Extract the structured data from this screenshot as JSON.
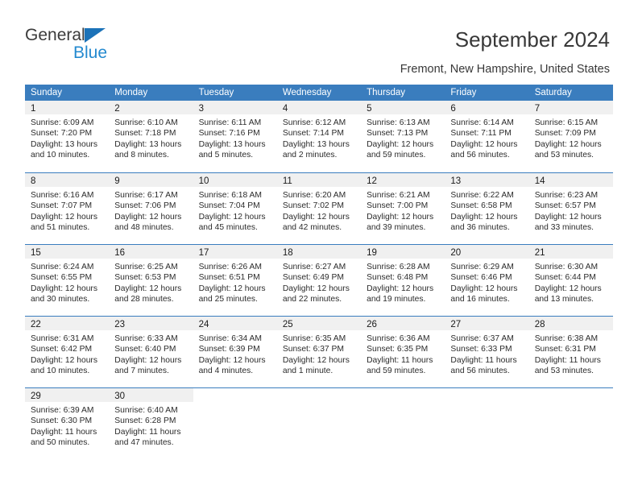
{
  "brand": {
    "name_top": "General",
    "name_bottom": "Blue",
    "accent_color": "#2389cf",
    "triangle_color": "#1b72b8"
  },
  "header": {
    "title": "September 2024",
    "location": "Fremont, New Hampshire, United States"
  },
  "theme": {
    "header_row_bg": "#3a7dbe",
    "daynum_bg": "#f0f0f0",
    "rule_color": "#3a7dbe",
    "text_color": "#2b2b2b"
  },
  "weekdays": [
    "Sunday",
    "Monday",
    "Tuesday",
    "Wednesday",
    "Thursday",
    "Friday",
    "Saturday"
  ],
  "weeks": [
    [
      {
        "day": "1",
        "sunrise": "Sunrise: 6:09 AM",
        "sunset": "Sunset: 7:20 PM",
        "daylight1": "Daylight: 13 hours",
        "daylight2": "and 10 minutes."
      },
      {
        "day": "2",
        "sunrise": "Sunrise: 6:10 AM",
        "sunset": "Sunset: 7:18 PM",
        "daylight1": "Daylight: 13 hours",
        "daylight2": "and 8 minutes."
      },
      {
        "day": "3",
        "sunrise": "Sunrise: 6:11 AM",
        "sunset": "Sunset: 7:16 PM",
        "daylight1": "Daylight: 13 hours",
        "daylight2": "and 5 minutes."
      },
      {
        "day": "4",
        "sunrise": "Sunrise: 6:12 AM",
        "sunset": "Sunset: 7:14 PM",
        "daylight1": "Daylight: 13 hours",
        "daylight2": "and 2 minutes."
      },
      {
        "day": "5",
        "sunrise": "Sunrise: 6:13 AM",
        "sunset": "Sunset: 7:13 PM",
        "daylight1": "Daylight: 12 hours",
        "daylight2": "and 59 minutes."
      },
      {
        "day": "6",
        "sunrise": "Sunrise: 6:14 AM",
        "sunset": "Sunset: 7:11 PM",
        "daylight1": "Daylight: 12 hours",
        "daylight2": "and 56 minutes."
      },
      {
        "day": "7",
        "sunrise": "Sunrise: 6:15 AM",
        "sunset": "Sunset: 7:09 PM",
        "daylight1": "Daylight: 12 hours",
        "daylight2": "and 53 minutes."
      }
    ],
    [
      {
        "day": "8",
        "sunrise": "Sunrise: 6:16 AM",
        "sunset": "Sunset: 7:07 PM",
        "daylight1": "Daylight: 12 hours",
        "daylight2": "and 51 minutes."
      },
      {
        "day": "9",
        "sunrise": "Sunrise: 6:17 AM",
        "sunset": "Sunset: 7:06 PM",
        "daylight1": "Daylight: 12 hours",
        "daylight2": "and 48 minutes."
      },
      {
        "day": "10",
        "sunrise": "Sunrise: 6:18 AM",
        "sunset": "Sunset: 7:04 PM",
        "daylight1": "Daylight: 12 hours",
        "daylight2": "and 45 minutes."
      },
      {
        "day": "11",
        "sunrise": "Sunrise: 6:20 AM",
        "sunset": "Sunset: 7:02 PM",
        "daylight1": "Daylight: 12 hours",
        "daylight2": "and 42 minutes."
      },
      {
        "day": "12",
        "sunrise": "Sunrise: 6:21 AM",
        "sunset": "Sunset: 7:00 PM",
        "daylight1": "Daylight: 12 hours",
        "daylight2": "and 39 minutes."
      },
      {
        "day": "13",
        "sunrise": "Sunrise: 6:22 AM",
        "sunset": "Sunset: 6:58 PM",
        "daylight1": "Daylight: 12 hours",
        "daylight2": "and 36 minutes."
      },
      {
        "day": "14",
        "sunrise": "Sunrise: 6:23 AM",
        "sunset": "Sunset: 6:57 PM",
        "daylight1": "Daylight: 12 hours",
        "daylight2": "and 33 minutes."
      }
    ],
    [
      {
        "day": "15",
        "sunrise": "Sunrise: 6:24 AM",
        "sunset": "Sunset: 6:55 PM",
        "daylight1": "Daylight: 12 hours",
        "daylight2": "and 30 minutes."
      },
      {
        "day": "16",
        "sunrise": "Sunrise: 6:25 AM",
        "sunset": "Sunset: 6:53 PM",
        "daylight1": "Daylight: 12 hours",
        "daylight2": "and 28 minutes."
      },
      {
        "day": "17",
        "sunrise": "Sunrise: 6:26 AM",
        "sunset": "Sunset: 6:51 PM",
        "daylight1": "Daylight: 12 hours",
        "daylight2": "and 25 minutes."
      },
      {
        "day": "18",
        "sunrise": "Sunrise: 6:27 AM",
        "sunset": "Sunset: 6:49 PM",
        "daylight1": "Daylight: 12 hours",
        "daylight2": "and 22 minutes."
      },
      {
        "day": "19",
        "sunrise": "Sunrise: 6:28 AM",
        "sunset": "Sunset: 6:48 PM",
        "daylight1": "Daylight: 12 hours",
        "daylight2": "and 19 minutes."
      },
      {
        "day": "20",
        "sunrise": "Sunrise: 6:29 AM",
        "sunset": "Sunset: 6:46 PM",
        "daylight1": "Daylight: 12 hours",
        "daylight2": "and 16 minutes."
      },
      {
        "day": "21",
        "sunrise": "Sunrise: 6:30 AM",
        "sunset": "Sunset: 6:44 PM",
        "daylight1": "Daylight: 12 hours",
        "daylight2": "and 13 minutes."
      }
    ],
    [
      {
        "day": "22",
        "sunrise": "Sunrise: 6:31 AM",
        "sunset": "Sunset: 6:42 PM",
        "daylight1": "Daylight: 12 hours",
        "daylight2": "and 10 minutes."
      },
      {
        "day": "23",
        "sunrise": "Sunrise: 6:33 AM",
        "sunset": "Sunset: 6:40 PM",
        "daylight1": "Daylight: 12 hours",
        "daylight2": "and 7 minutes."
      },
      {
        "day": "24",
        "sunrise": "Sunrise: 6:34 AM",
        "sunset": "Sunset: 6:39 PM",
        "daylight1": "Daylight: 12 hours",
        "daylight2": "and 4 minutes."
      },
      {
        "day": "25",
        "sunrise": "Sunrise: 6:35 AM",
        "sunset": "Sunset: 6:37 PM",
        "daylight1": "Daylight: 12 hours",
        "daylight2": "and 1 minute."
      },
      {
        "day": "26",
        "sunrise": "Sunrise: 6:36 AM",
        "sunset": "Sunset: 6:35 PM",
        "daylight1": "Daylight: 11 hours",
        "daylight2": "and 59 minutes."
      },
      {
        "day": "27",
        "sunrise": "Sunrise: 6:37 AM",
        "sunset": "Sunset: 6:33 PM",
        "daylight1": "Daylight: 11 hours",
        "daylight2": "and 56 minutes."
      },
      {
        "day": "28",
        "sunrise": "Sunrise: 6:38 AM",
        "sunset": "Sunset: 6:31 PM",
        "daylight1": "Daylight: 11 hours",
        "daylight2": "and 53 minutes."
      }
    ],
    [
      {
        "day": "29",
        "sunrise": "Sunrise: 6:39 AM",
        "sunset": "Sunset: 6:30 PM",
        "daylight1": "Daylight: 11 hours",
        "daylight2": "and 50 minutes."
      },
      {
        "day": "30",
        "sunrise": "Sunrise: 6:40 AM",
        "sunset": "Sunset: 6:28 PM",
        "daylight1": "Daylight: 11 hours",
        "daylight2": "and 47 minutes."
      },
      {
        "day": "",
        "sunrise": "",
        "sunset": "",
        "daylight1": "",
        "daylight2": ""
      },
      {
        "day": "",
        "sunrise": "",
        "sunset": "",
        "daylight1": "",
        "daylight2": ""
      },
      {
        "day": "",
        "sunrise": "",
        "sunset": "",
        "daylight1": "",
        "daylight2": ""
      },
      {
        "day": "",
        "sunrise": "",
        "sunset": "",
        "daylight1": "",
        "daylight2": ""
      },
      {
        "day": "",
        "sunrise": "",
        "sunset": "",
        "daylight1": "",
        "daylight2": ""
      }
    ]
  ]
}
